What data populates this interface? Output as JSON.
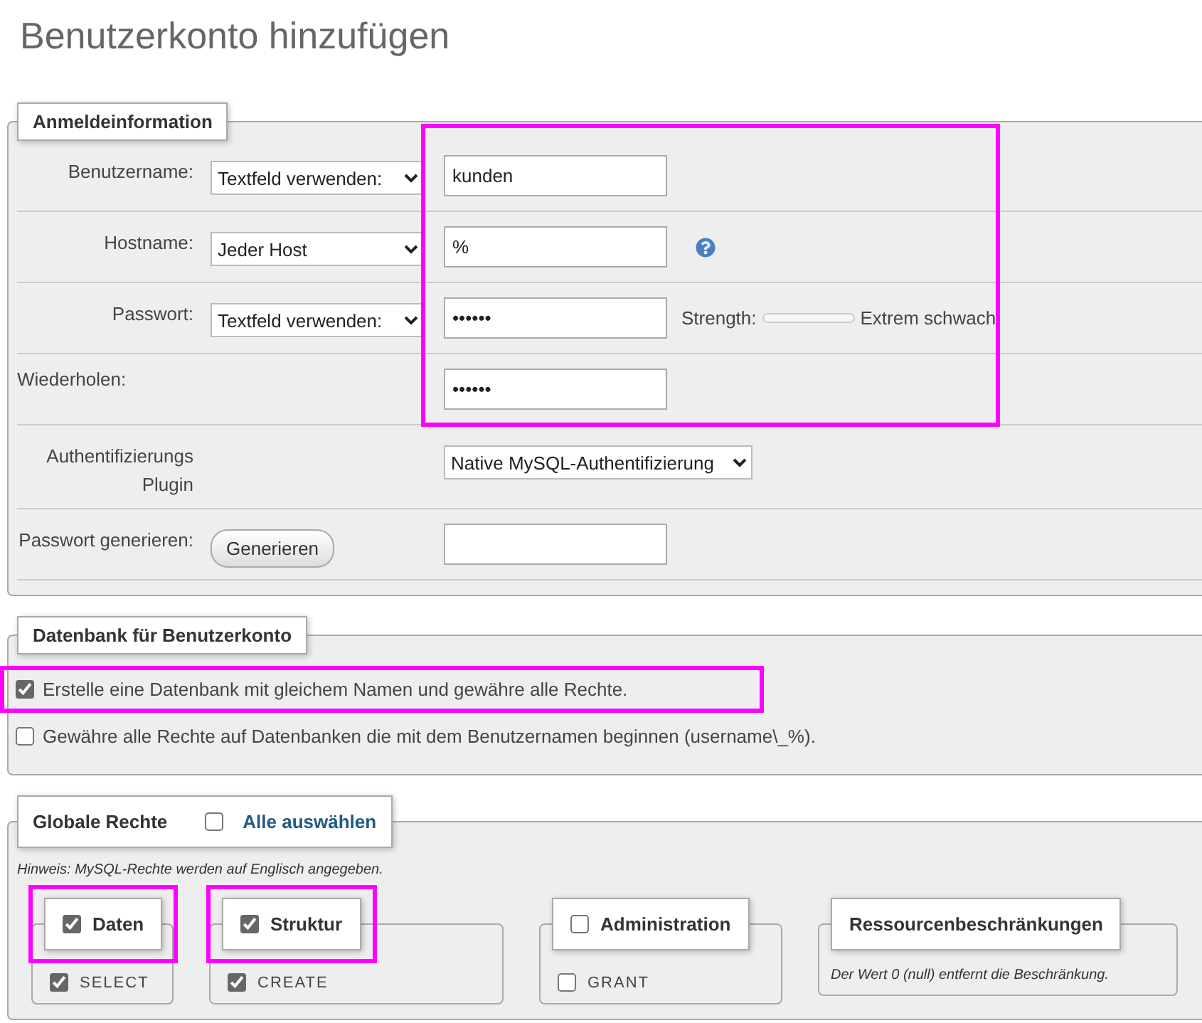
{
  "page_title": "Benutzerkonto hinzufügen",
  "login": {
    "legend": "Anmeldeinformation",
    "rows": [
      {
        "kind": "select_input",
        "label": "Benutzername:",
        "select": "Textfeld verwenden:",
        "value": "kunden",
        "highlighted": true
      },
      {
        "kind": "select_input_help",
        "label": "Hostname:",
        "select": "Jeder Host",
        "value": "%",
        "highlighted": true
      },
      {
        "kind": "password_strength",
        "label": "Passwort:",
        "select": "Textfeld verwenden:",
        "value": "••••••",
        "strength_label": "Strength:",
        "strength_text": "Extrem schwach",
        "highlighted": true
      },
      {
        "kind": "input",
        "label": "Wiederholen:",
        "value": "••••••",
        "highlighted": true
      },
      {
        "kind": "select",
        "label": "Authentifizierungs Plugin",
        "select": "Native MySQL-Authentifizierung",
        "highlighted": false
      },
      {
        "kind": "generate",
        "label": "Passwort generieren:",
        "button": "Generieren",
        "highlighted": false
      }
    ]
  },
  "database": {
    "legend": "Datenbank für Benutzerkonto",
    "options": [
      {
        "label": "Erstelle eine Datenbank mit gleichem Namen und gewähre alle Rechte.",
        "checked": true,
        "highlighted": true
      },
      {
        "label": "Gewähre alle Rechte auf Datenbanken die mit dem Benutzernamen beginnen (username\\_%).",
        "checked": false,
        "highlighted": false
      }
    ]
  },
  "global": {
    "legend": "Globale Rechte",
    "select_all": {
      "label": "Alle auswählen",
      "checked": false
    },
    "note": "Hinweis: MySQL-Rechte werden auf Englisch angegeben.",
    "groups": [
      {
        "kind": "privileges",
        "title": "Daten",
        "checked": true,
        "highlighted": true,
        "items": [
          {
            "label": "SELECT",
            "checked": true
          }
        ]
      },
      {
        "kind": "privileges",
        "title": "Struktur",
        "checked": true,
        "highlighted": true,
        "items": [
          {
            "label": "CREATE",
            "checked": true
          }
        ]
      },
      {
        "kind": "privileges",
        "title": "Administration",
        "checked": false,
        "highlighted": false,
        "items": [
          {
            "label": "GRANT",
            "checked": false
          }
        ]
      },
      {
        "kind": "limits",
        "title": "Ressourcenbeschränkungen",
        "highlighted": false,
        "note": "Der Wert 0 (null) entfernt die Beschränkung."
      }
    ]
  }
}
